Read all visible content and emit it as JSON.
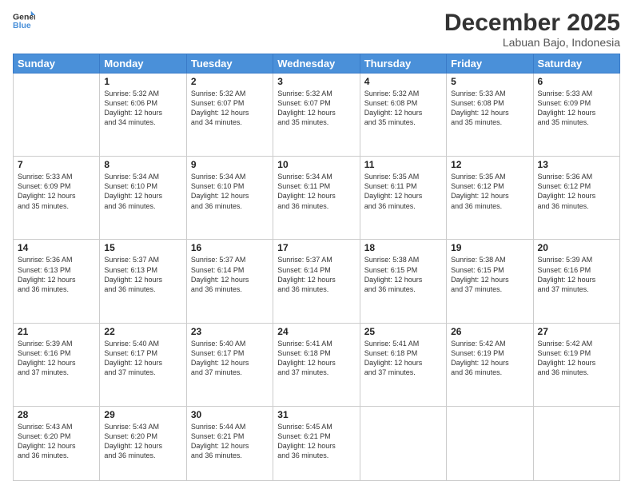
{
  "logo": {
    "line1": "General",
    "line2": "Blue"
  },
  "title": "December 2025",
  "subtitle": "Labuan Bajo, Indonesia",
  "days_of_week": [
    "Sunday",
    "Monday",
    "Tuesday",
    "Wednesday",
    "Thursday",
    "Friday",
    "Saturday"
  ],
  "weeks": [
    [
      {
        "day": "",
        "info": ""
      },
      {
        "day": "1",
        "info": "Sunrise: 5:32 AM\nSunset: 6:06 PM\nDaylight: 12 hours\nand 34 minutes."
      },
      {
        "day": "2",
        "info": "Sunrise: 5:32 AM\nSunset: 6:07 PM\nDaylight: 12 hours\nand 34 minutes."
      },
      {
        "day": "3",
        "info": "Sunrise: 5:32 AM\nSunset: 6:07 PM\nDaylight: 12 hours\nand 35 minutes."
      },
      {
        "day": "4",
        "info": "Sunrise: 5:32 AM\nSunset: 6:08 PM\nDaylight: 12 hours\nand 35 minutes."
      },
      {
        "day": "5",
        "info": "Sunrise: 5:33 AM\nSunset: 6:08 PM\nDaylight: 12 hours\nand 35 minutes."
      },
      {
        "day": "6",
        "info": "Sunrise: 5:33 AM\nSunset: 6:09 PM\nDaylight: 12 hours\nand 35 minutes."
      }
    ],
    [
      {
        "day": "7",
        "info": "Sunrise: 5:33 AM\nSunset: 6:09 PM\nDaylight: 12 hours\nand 35 minutes."
      },
      {
        "day": "8",
        "info": "Sunrise: 5:34 AM\nSunset: 6:10 PM\nDaylight: 12 hours\nand 36 minutes."
      },
      {
        "day": "9",
        "info": "Sunrise: 5:34 AM\nSunset: 6:10 PM\nDaylight: 12 hours\nand 36 minutes."
      },
      {
        "day": "10",
        "info": "Sunrise: 5:34 AM\nSunset: 6:11 PM\nDaylight: 12 hours\nand 36 minutes."
      },
      {
        "day": "11",
        "info": "Sunrise: 5:35 AM\nSunset: 6:11 PM\nDaylight: 12 hours\nand 36 minutes."
      },
      {
        "day": "12",
        "info": "Sunrise: 5:35 AM\nSunset: 6:12 PM\nDaylight: 12 hours\nand 36 minutes."
      },
      {
        "day": "13",
        "info": "Sunrise: 5:36 AM\nSunset: 6:12 PM\nDaylight: 12 hours\nand 36 minutes."
      }
    ],
    [
      {
        "day": "14",
        "info": "Sunrise: 5:36 AM\nSunset: 6:13 PM\nDaylight: 12 hours\nand 36 minutes."
      },
      {
        "day": "15",
        "info": "Sunrise: 5:37 AM\nSunset: 6:13 PM\nDaylight: 12 hours\nand 36 minutes."
      },
      {
        "day": "16",
        "info": "Sunrise: 5:37 AM\nSunset: 6:14 PM\nDaylight: 12 hours\nand 36 minutes."
      },
      {
        "day": "17",
        "info": "Sunrise: 5:37 AM\nSunset: 6:14 PM\nDaylight: 12 hours\nand 36 minutes."
      },
      {
        "day": "18",
        "info": "Sunrise: 5:38 AM\nSunset: 6:15 PM\nDaylight: 12 hours\nand 36 minutes."
      },
      {
        "day": "19",
        "info": "Sunrise: 5:38 AM\nSunset: 6:15 PM\nDaylight: 12 hours\nand 37 minutes."
      },
      {
        "day": "20",
        "info": "Sunrise: 5:39 AM\nSunset: 6:16 PM\nDaylight: 12 hours\nand 37 minutes."
      }
    ],
    [
      {
        "day": "21",
        "info": "Sunrise: 5:39 AM\nSunset: 6:16 PM\nDaylight: 12 hours\nand 37 minutes."
      },
      {
        "day": "22",
        "info": "Sunrise: 5:40 AM\nSunset: 6:17 PM\nDaylight: 12 hours\nand 37 minutes."
      },
      {
        "day": "23",
        "info": "Sunrise: 5:40 AM\nSunset: 6:17 PM\nDaylight: 12 hours\nand 37 minutes."
      },
      {
        "day": "24",
        "info": "Sunrise: 5:41 AM\nSunset: 6:18 PM\nDaylight: 12 hours\nand 37 minutes."
      },
      {
        "day": "25",
        "info": "Sunrise: 5:41 AM\nSunset: 6:18 PM\nDaylight: 12 hours\nand 37 minutes."
      },
      {
        "day": "26",
        "info": "Sunrise: 5:42 AM\nSunset: 6:19 PM\nDaylight: 12 hours\nand 36 minutes."
      },
      {
        "day": "27",
        "info": "Sunrise: 5:42 AM\nSunset: 6:19 PM\nDaylight: 12 hours\nand 36 minutes."
      }
    ],
    [
      {
        "day": "28",
        "info": "Sunrise: 5:43 AM\nSunset: 6:20 PM\nDaylight: 12 hours\nand 36 minutes."
      },
      {
        "day": "29",
        "info": "Sunrise: 5:43 AM\nSunset: 6:20 PM\nDaylight: 12 hours\nand 36 minutes."
      },
      {
        "day": "30",
        "info": "Sunrise: 5:44 AM\nSunset: 6:21 PM\nDaylight: 12 hours\nand 36 minutes."
      },
      {
        "day": "31",
        "info": "Sunrise: 5:45 AM\nSunset: 6:21 PM\nDaylight: 12 hours\nand 36 minutes."
      },
      {
        "day": "",
        "info": ""
      },
      {
        "day": "",
        "info": ""
      },
      {
        "day": "",
        "info": ""
      }
    ]
  ]
}
